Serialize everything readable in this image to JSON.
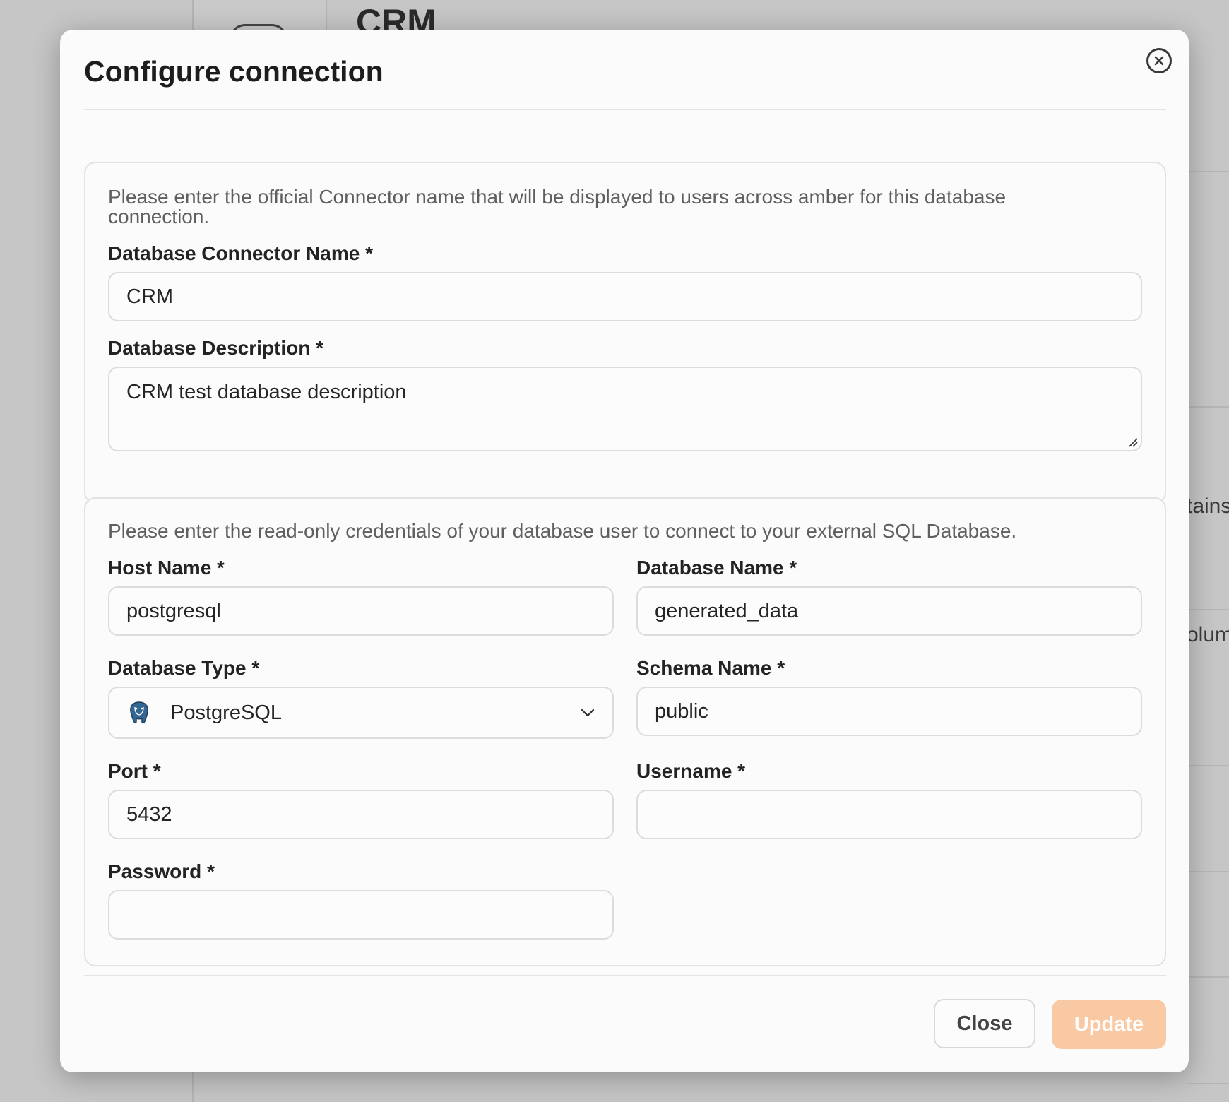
{
  "background": {
    "app_title": "CRM",
    "fragment_1": "tains",
    "fragment_2": "olum"
  },
  "modal": {
    "title": "Configure connection",
    "close_icon": "close-circle-icon"
  },
  "section1": {
    "hint": "Please enter the official Connector name that will be displayed to users across amber for this database connection.",
    "connector_name": {
      "label": "Database Connector Name *",
      "value": "CRM"
    },
    "description": {
      "label": "Database Description *",
      "value": "CRM test database description"
    }
  },
  "section2": {
    "hint": "Please enter the read-only credentials of your database user to connect to your external SQL Database.",
    "host_name": {
      "label": "Host Name *",
      "value": "postgresql"
    },
    "database_name": {
      "label": "Database Name *",
      "value": "generated_data"
    },
    "database_type": {
      "label": "Database Type *",
      "value": "PostgreSQL",
      "icon": "postgresql-elephant-icon"
    },
    "schema_name": {
      "label": "Schema Name *",
      "value": "public"
    },
    "port": {
      "label": "Port *",
      "value": "5432"
    },
    "username": {
      "label": "Username *",
      "value": ""
    },
    "password": {
      "label": "Password *",
      "value": ""
    }
  },
  "footer": {
    "close_label": "Close",
    "update_label": "Update",
    "update_color": "#f9c9a4"
  }
}
